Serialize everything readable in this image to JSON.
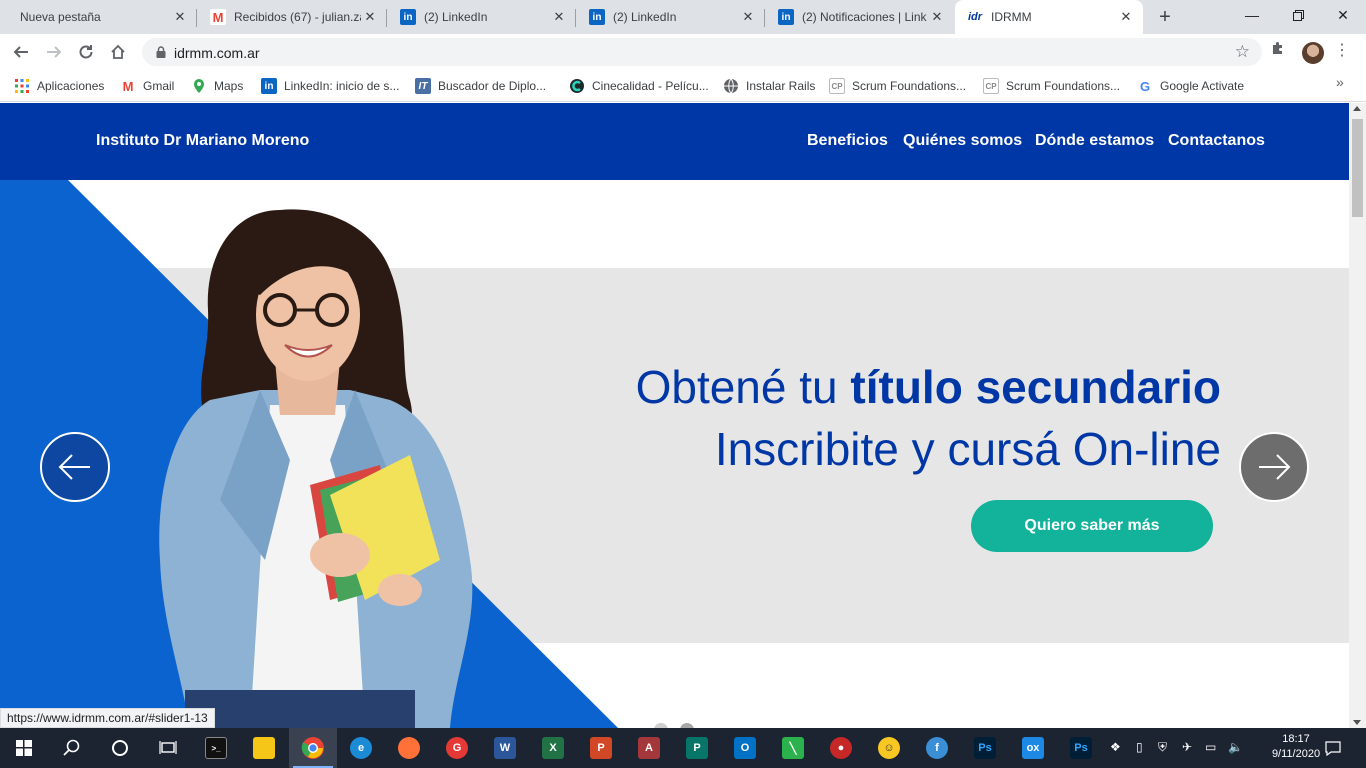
{
  "browser": {
    "tabs": [
      {
        "title": "Nueva pestaña",
        "icon": "blank-tab-icon"
      },
      {
        "title": "Recibidos (67) - julian.za",
        "icon": "gmail-icon"
      },
      {
        "title": "(2) LinkedIn",
        "icon": "linkedin-icon"
      },
      {
        "title": "(2) LinkedIn",
        "icon": "linkedin-icon"
      },
      {
        "title": "(2) Notificaciones | Link",
        "icon": "linkedin-icon"
      },
      {
        "title": "IDRMM",
        "icon": "idrmm-icon"
      }
    ],
    "url": "idrmm.com.ar",
    "bookmarks": [
      {
        "label": "Aplicaciones",
        "icon": "apps-grid-icon"
      },
      {
        "label": "Gmail",
        "icon": "gmail-icon"
      },
      {
        "label": "Maps",
        "icon": "maps-icon"
      },
      {
        "label": "LinkedIn: inicio de s...",
        "icon": "linkedin-icon"
      },
      {
        "label": "Buscador de Diplo...",
        "icon": "it-icon"
      },
      {
        "label": "Cinecalidad - Pelícu...",
        "icon": "cinecalidad-icon"
      },
      {
        "label": "Instalar Rails",
        "icon": "globe-icon"
      },
      {
        "label": "Scrum Foundations...",
        "icon": "cp-icon"
      },
      {
        "label": "Scrum Foundations...",
        "icon": "cp-icon"
      },
      {
        "label": "Google Activate",
        "icon": "google-icon"
      }
    ],
    "status_url": "https://www.idrmm.com.ar/#slider1-13"
  },
  "site": {
    "brand": "Instituto Dr Mariano Moreno",
    "nav": [
      "Beneficios",
      "Quiénes somos",
      "Dónde estamos",
      "Contactanos"
    ],
    "hero": {
      "line1_prefix": "Obtené tu ",
      "line1_bold": "título secundario",
      "line2": "Inscribite y cursá On-line",
      "cta": "Quiero saber más"
    },
    "colors": {
      "primary": "#0037a6",
      "accent": "#12b39a",
      "panel": "#e6e6e6"
    }
  },
  "taskbar": {
    "time": "18:17",
    "date": "9/11/2020"
  }
}
